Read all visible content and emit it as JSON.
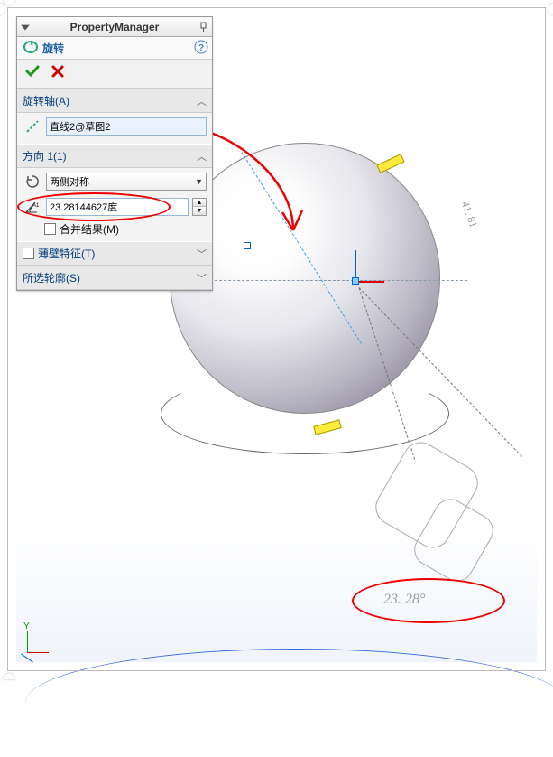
{
  "panel": {
    "title": "PropertyManager",
    "feature_name": "旋转",
    "sections": {
      "axis": {
        "header": "旋转轴(A)",
        "value": "直线2@草图2"
      },
      "direction": {
        "header": "方向 1(1)",
        "end_condition": "两侧对称",
        "angle_value": "23.28144627度",
        "merge_label": "合并结果(M)"
      },
      "thin": {
        "header": "薄壁特征(T)"
      },
      "contours": {
        "header": "所选轮廓(S)"
      }
    }
  },
  "viewport": {
    "dim_label_main": "23. 28°",
    "dim_label_side": "41. 81",
    "csys_y": "Y"
  }
}
